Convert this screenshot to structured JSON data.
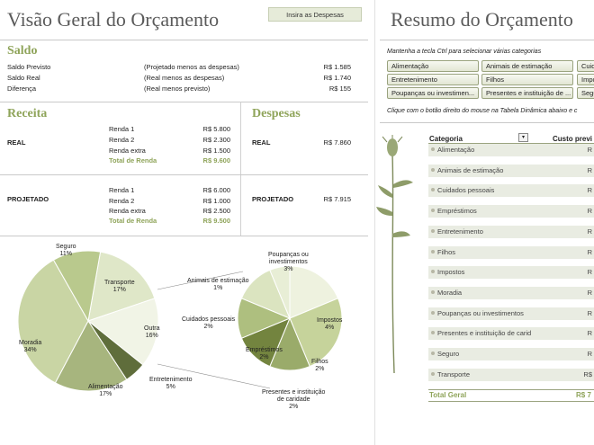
{
  "left": {
    "title": "Visão Geral do Orçamento",
    "insert_button": "Insira as Despesas",
    "saldo": {
      "heading": "Saldo",
      "rows": [
        {
          "label": "Saldo Previsto",
          "desc": "(Projetado menos as despesas)",
          "value": "R$ 1.585"
        },
        {
          "label": "Saldo Real",
          "desc": "(Real menos as despesas)",
          "value": "R$ 1.740"
        },
        {
          "label": "Diferença",
          "desc": "(Real menos previsto)",
          "value": "R$ 155"
        }
      ]
    },
    "receita": {
      "heading": "Receita",
      "real": {
        "label": "REAL",
        "items": [
          {
            "name": "Renda 1",
            "value": "R$ 5.800"
          },
          {
            "name": "Renda 2",
            "value": "R$ 2.300"
          },
          {
            "name": "Renda extra",
            "value": "R$ 1.500"
          }
        ],
        "total_label": "Total de Renda",
        "total_value": "R$ 9.600"
      },
      "projetado": {
        "label": "PROJETADO",
        "items": [
          {
            "name": "Renda 1",
            "value": "R$ 6.000"
          },
          {
            "name": "Renda 2",
            "value": "R$ 1.000"
          },
          {
            "name": "Renda extra",
            "value": "R$ 2.500"
          }
        ],
        "total_label": "Total de Renda",
        "total_value": "R$ 9.500"
      }
    },
    "despesas": {
      "heading": "Despesas",
      "real_label": "REAL",
      "real_value": "R$ 7.860",
      "proj_label": "PROJETADO",
      "proj_value": "R$ 7.915"
    }
  },
  "chart_data": [
    {
      "type": "pie",
      "slices": [
        {
          "label": "Transporte",
          "value": 17,
          "color": "#dfe7c8"
        },
        {
          "label": "Outra",
          "value": 16,
          "color": "#f1f4e6"
        },
        {
          "label": "Entretenimento",
          "value": 5,
          "color": "#5f6d3b"
        },
        {
          "label": "Alimentação",
          "value": 17,
          "color": "#a7b57e"
        },
        {
          "label": "Moradia",
          "value": 34,
          "color": "#c9d5a4"
        },
        {
          "label": "Seguro",
          "value": 11,
          "color": "#b9c98d"
        }
      ],
      "labels": [
        {
          "name": "Transporte",
          "pct": "17%"
        },
        {
          "name": "Outra",
          "pct": "16%"
        },
        {
          "name": "Entretenimento",
          "pct": "5%"
        },
        {
          "name": "Alimentação",
          "pct": "17%"
        },
        {
          "name": "Moradia",
          "pct": "34%"
        },
        {
          "name": "Seguro",
          "pct": "11%"
        }
      ]
    },
    {
      "type": "pie",
      "slices": [
        {
          "label": "Poupanças ou investimentos",
          "value": 3,
          "color": "#eef2df"
        },
        {
          "label": "Impostos",
          "value": 4,
          "color": "#c6d39b"
        },
        {
          "label": "Filhos",
          "value": 2,
          "color": "#9aab6a"
        },
        {
          "label": "Presentes e instituição de caridade",
          "value": 2,
          "color": "#73843f"
        },
        {
          "label": "Empréstimos",
          "value": 2,
          "color": "#aebf7f"
        },
        {
          "label": "Cuidados pessoais",
          "value": 2,
          "color": "#dbe4c0"
        },
        {
          "label": "Animais de estimação",
          "value": 1,
          "color": "#e8eed6"
        }
      ],
      "labels": [
        {
          "name": "Poupanças ou investimentos",
          "line1": "Poupanças ou",
          "line2": "investimentos",
          "pct": "3%"
        },
        {
          "name": "Impostos",
          "pct": "4%"
        },
        {
          "name": "Filhos",
          "pct": "2%"
        },
        {
          "name": "Presentes e instituição de caridade",
          "line1": "Presentes e instituição",
          "line2": "de caridade",
          "pct": "2%"
        },
        {
          "name": "Empréstimos",
          "pct": "2%"
        },
        {
          "name": "Cuidados pessoais",
          "pct": "2%"
        },
        {
          "name": "Animais de estimação",
          "pct": "1%"
        }
      ]
    }
  ],
  "right": {
    "title": "Resumo do Orçamento",
    "hint": "Mantenha a tecla Ctrl para selecionar várias categorias",
    "slicers": [
      "Alimentação",
      "Animais de estimação",
      "Cuid",
      "Entretenimento",
      "Filhos",
      "Impo",
      "Poupanças ou investimen...",
      "Presentes e instituição de ...",
      "Segu"
    ],
    "right_click_hint": "Clique com o botão direito do mouse na Tabela Dinâmica abaixo e c",
    "pivot": {
      "col_category": "Categoria",
      "col_cost": "Custo previ",
      "rows": [
        {
          "name": "Alimentação",
          "val": "R"
        },
        {
          "name": "Animais de estimação",
          "val": "R"
        },
        {
          "name": "Cuidados pessoais",
          "val": "R"
        },
        {
          "name": "Empréstimos",
          "val": "R"
        },
        {
          "name": "Entretenimento",
          "val": "R"
        },
        {
          "name": "Filhos",
          "val": "R"
        },
        {
          "name": "Impostos",
          "val": "R"
        },
        {
          "name": "Moradia",
          "val": "R"
        },
        {
          "name": "Poupanças ou investimentos",
          "val": "R"
        },
        {
          "name": "Presentes e instituição de carid",
          "val": "R"
        },
        {
          "name": "Seguro",
          "val": "R"
        },
        {
          "name": "Transporte",
          "val": "R$"
        }
      ],
      "total_label": "Total Geral",
      "total_value": "R$ 7"
    }
  }
}
